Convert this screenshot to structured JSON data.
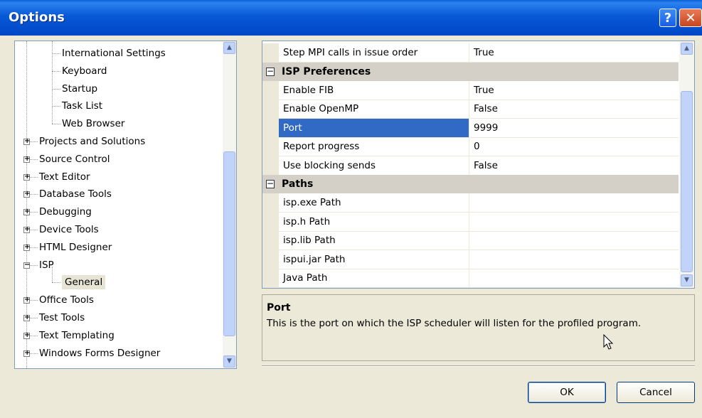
{
  "window": {
    "title": "Options",
    "help_glyph": "?",
    "close_glyph": "✕"
  },
  "tree": {
    "items": [
      {
        "label": "International Settings",
        "level": 2,
        "expander": ""
      },
      {
        "label": "Keyboard",
        "level": 2,
        "expander": ""
      },
      {
        "label": "Startup",
        "level": 2,
        "expander": ""
      },
      {
        "label": "Task List",
        "level": 2,
        "expander": ""
      },
      {
        "label": "Web Browser",
        "level": 2,
        "expander": ""
      },
      {
        "label": "Projects and Solutions",
        "level": 1,
        "expander": "+"
      },
      {
        "label": "Source Control",
        "level": 1,
        "expander": "+"
      },
      {
        "label": "Text Editor",
        "level": 1,
        "expander": "+"
      },
      {
        "label": "Database Tools",
        "level": 1,
        "expander": "+"
      },
      {
        "label": "Debugging",
        "level": 1,
        "expander": "+"
      },
      {
        "label": "Device Tools",
        "level": 1,
        "expander": "+"
      },
      {
        "label": "HTML Designer",
        "level": 1,
        "expander": "+"
      },
      {
        "label": "ISP",
        "level": 1,
        "expander": "−"
      },
      {
        "label": "General",
        "level": 2,
        "expander": "",
        "selected": true
      },
      {
        "label": "Office Tools",
        "level": 1,
        "expander": "+"
      },
      {
        "label": "Test Tools",
        "level": 1,
        "expander": "+"
      },
      {
        "label": "Text Templating",
        "level": 1,
        "expander": "+"
      },
      {
        "label": "Windows Forms Designer",
        "level": 1,
        "expander": "+"
      }
    ]
  },
  "grid": {
    "rows": [
      {
        "type": "prop",
        "name": "Step MPI calls in issue order",
        "value": "True"
      },
      {
        "type": "cat",
        "name": "ISP Preferences",
        "expander": "−"
      },
      {
        "type": "prop",
        "name": "Enable FIB",
        "value": "True"
      },
      {
        "type": "prop",
        "name": "Enable OpenMP",
        "value": "False"
      },
      {
        "type": "prop",
        "name": "Port",
        "value": "9999",
        "selected": true
      },
      {
        "type": "prop",
        "name": "Report progress",
        "value": "0"
      },
      {
        "type": "prop",
        "name": "Use blocking sends",
        "value": "False"
      },
      {
        "type": "cat",
        "name": "Paths",
        "expander": "−"
      },
      {
        "type": "prop",
        "name": "isp.exe Path",
        "value": ""
      },
      {
        "type": "prop",
        "name": "isp.h Path",
        "value": ""
      },
      {
        "type": "prop",
        "name": "isp.lib Path",
        "value": ""
      },
      {
        "type": "prop",
        "name": "ispui.jar Path",
        "value": ""
      },
      {
        "type": "prop",
        "name": "Java Path",
        "value": ""
      }
    ]
  },
  "help": {
    "title": "Port",
    "description": "This is the port on which the ISP scheduler will listen for the profiled program."
  },
  "buttons": {
    "ok": "OK",
    "cancel": "Cancel"
  },
  "icons": {
    "scroll_up": "▲",
    "scroll_down": "▼",
    "tree_expander": "+",
    "category_expander": "−",
    "cursor": "arrow-pointer"
  }
}
